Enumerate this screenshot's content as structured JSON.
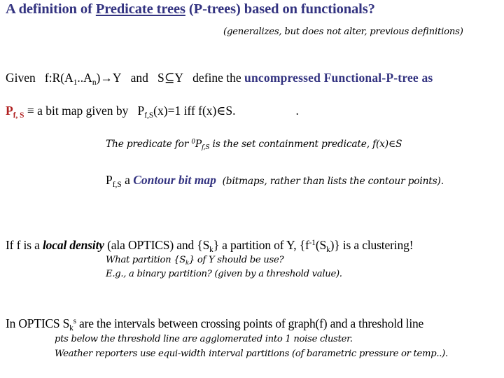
{
  "title": {
    "prefix": "A definition of ",
    "underlined": "Predicate trees",
    "suffix": " (P-trees) based on functionals?"
  },
  "subtitle": "(generalizes, but does not alter, previous definitions)",
  "given_line": {
    "given": "Given",
    "func_prefix": "f:R(A",
    "sub1": "1",
    "dots": "..A",
    "subn": "n",
    "func_suffix": ")→Y",
    "and": "and",
    "subset": "S⊆Y",
    "define": "define the ",
    "emphasis": "uncompressed Functional-P-tree as"
  },
  "pdef_line": {
    "symbol": "P",
    "symbol_sub": "f, S",
    "equiv": " ≡ a bit map given by",
    "p": "P",
    "p_sub": "f,S",
    "cond": "(x)=1 iff f(x)∈S.",
    "trailing_dot": "."
  },
  "predicate_line": {
    "before": "The predicate for ",
    "sup": "0",
    "p": "P",
    "p_sub": "f,S",
    "after": " is the set containment predicate, f(x)∈S"
  },
  "contour_line": {
    "p": "P",
    "p_sub": "f,S",
    "a": " a ",
    "emphasis": "Contour bit map",
    "paren": "(bitmaps, rather than lists the contour points)."
  },
  "local_line": {
    "before": "If f is a ",
    "emphasis": "local density",
    "mid1": " (ala OPTICS) and {S",
    "sub_k1": "k",
    "mid2": "} a partition of Y,  {f",
    "sup": "-1",
    "mid3": "(S",
    "sub_k2": "k",
    "after": ")} is a clustering!"
  },
  "question_line": {
    "before": "What partition {S",
    "sub": "k",
    "after": "} of Y  should be use?"
  },
  "example_line": "E.g., a binary partition? (given by a threshold value).",
  "optics_line": {
    "before": "In OPTICS S",
    "sub": "k",
    "sup": "s",
    "after": " are the intervals between crossing points of graph(f) and a threshold line"
  },
  "note1": "pts below the threshold line are agglomerated into 1 noise cluster.",
  "note2": "Weather reporters use equi-width interval partitions (of barametric pressure or temp..).",
  "colors": {
    "title": "#333380",
    "emphasis": "#333380",
    "symbol": "#b02020",
    "text": "#000000"
  }
}
